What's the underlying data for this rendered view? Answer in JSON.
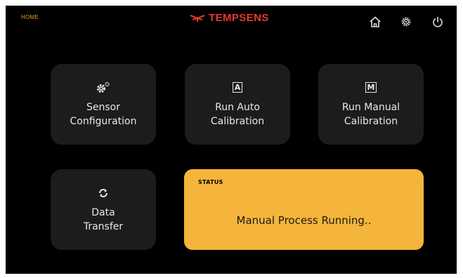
{
  "header": {
    "screen_label": "HOME",
    "brand_name": "TEMPSENS",
    "brand_color": "#e23a2c",
    "icons": [
      "home-icon",
      "settings-icon",
      "power-icon"
    ]
  },
  "tiles": [
    {
      "icon": "gear-icon",
      "line1": "Sensor",
      "line2": "Configuration"
    },
    {
      "icon": "auto-calibration-icon",
      "icon_text": "A",
      "line1": "Run Auto",
      "line2": "Calibration"
    },
    {
      "icon": "manual-calibration-icon",
      "icon_text": "M",
      "line1": "Run Manual",
      "line2": "Calibration"
    },
    {
      "icon": "sync-icon",
      "line1": "Data",
      "line2": "Transfer"
    }
  ],
  "status": {
    "label": "STATUS",
    "message": "Manual Process Running..",
    "color": "#f5b43a"
  }
}
